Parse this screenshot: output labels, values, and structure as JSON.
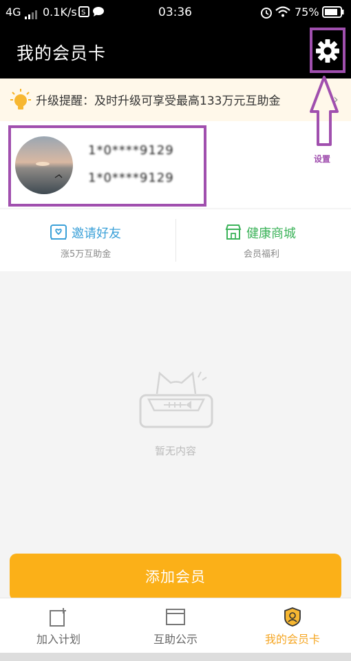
{
  "status_bar": {
    "network": "4G",
    "speed": "0.1K/s",
    "time": "03:36",
    "battery": "75%"
  },
  "header": {
    "title": "我的会员卡",
    "settings_icon": "gear-icon"
  },
  "reminder": {
    "icon": "bulb-icon",
    "text": "升级提醒：及时升级可享受最高133万元互助金"
  },
  "profile": {
    "line1": "1*0****9129",
    "line2": "1*0****9129"
  },
  "quick_links": [
    {
      "title": "邀请好友",
      "subtitle": "涨5万互助金",
      "icon": "invite-icon",
      "color": "#3aa0d8"
    },
    {
      "title": "健康商城",
      "subtitle": "会员福利",
      "icon": "store-icon",
      "color": "#3cb35a"
    }
  ],
  "empty_state": {
    "text": "暂无内容",
    "icon": "empty-cat-icon"
  },
  "add_member_button": "添加会员",
  "tabs": [
    {
      "label": "加入计划",
      "icon": "join-plan-icon"
    },
    {
      "label": "互助公示",
      "icon": "public-notice-icon"
    },
    {
      "label": "我的会员卡",
      "icon": "member-card-icon",
      "active": true,
      "color": "#f5a623"
    }
  ],
  "annotation": {
    "label": "设置",
    "color": "#a04fae"
  }
}
